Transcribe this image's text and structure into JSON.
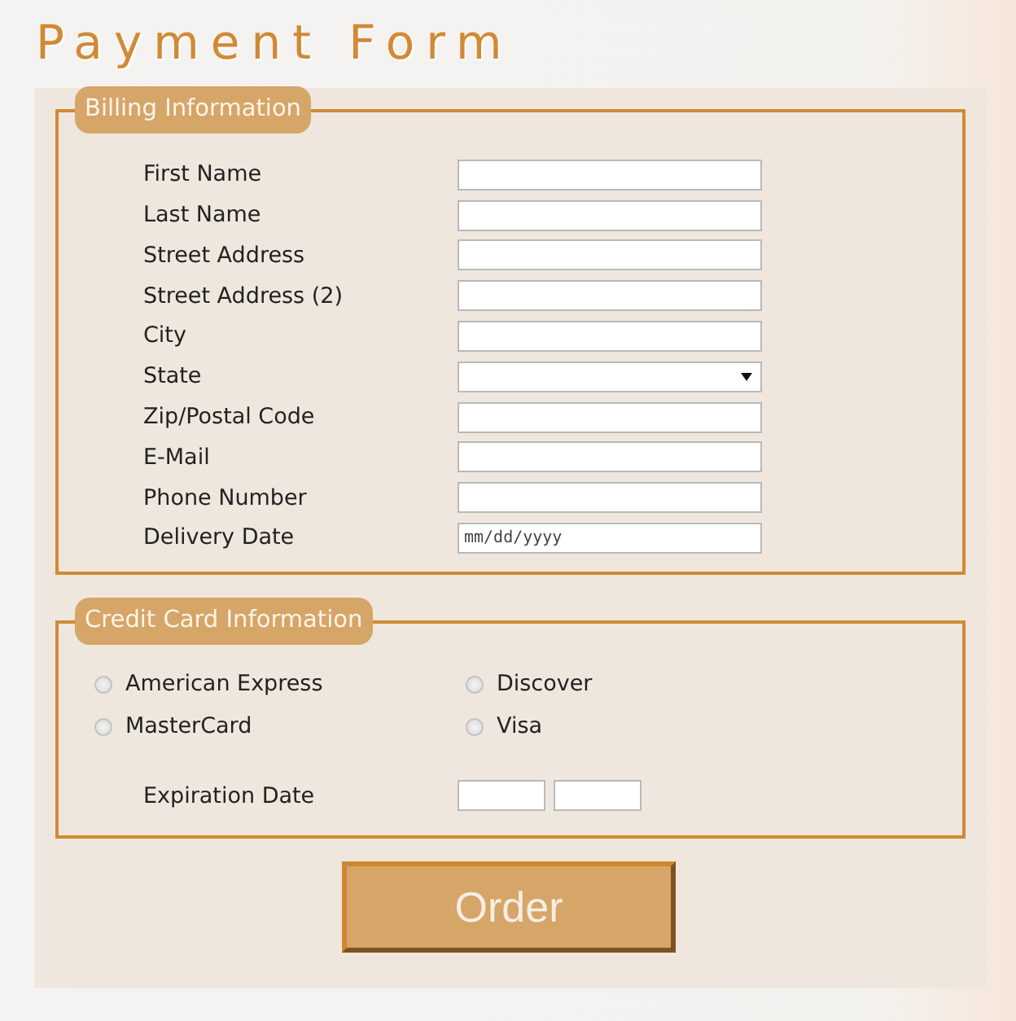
{
  "title": "Payment Form",
  "billing": {
    "legend": "Billing Information",
    "fields": [
      {
        "label": "First Name",
        "kind": "text"
      },
      {
        "label": "Last Name",
        "kind": "text"
      },
      {
        "label": "Street Address",
        "kind": "text"
      },
      {
        "label": "Street Address (2)",
        "kind": "text"
      },
      {
        "label": "City",
        "kind": "text"
      },
      {
        "label": "State",
        "kind": "select"
      },
      {
        "label": "Zip/Postal Code",
        "kind": "text"
      },
      {
        "label": "E-Mail",
        "kind": "text"
      },
      {
        "label": "Phone Number",
        "kind": "text"
      },
      {
        "label": "Delivery Date",
        "kind": "date",
        "placeholder": "mm/dd/yyyy"
      }
    ]
  },
  "credit_card": {
    "legend": "Credit Card Information",
    "cards": [
      {
        "label": "American Express",
        "selected": false
      },
      {
        "label": "Discover",
        "selected": false
      },
      {
        "label": "MasterCard",
        "selected": false
      },
      {
        "label": "Visa",
        "selected": false
      }
    ],
    "expiration_label": "Expiration Date"
  },
  "order_button": "Order"
}
